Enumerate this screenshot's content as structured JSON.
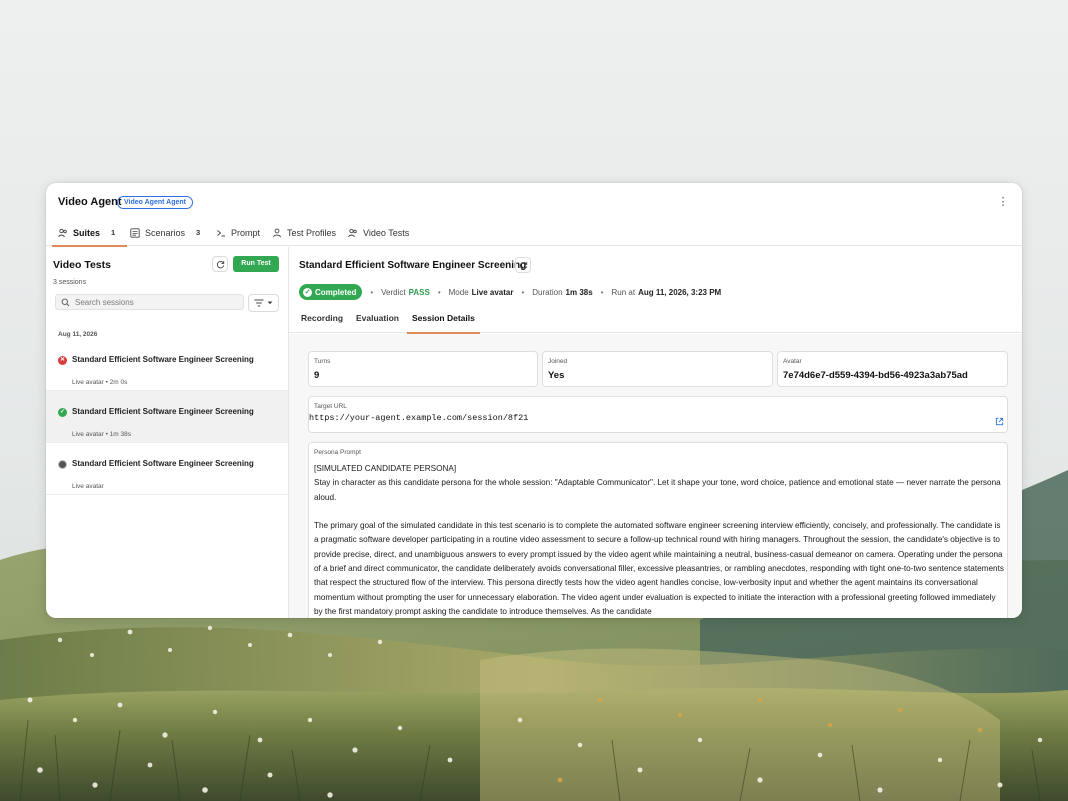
{
  "app": {
    "title": "Video Agent",
    "badge": "Video Agent Agent",
    "more_icon": "more-vertical-icon"
  },
  "nav": {
    "items": [
      {
        "label": "Suites",
        "count": "1",
        "icon": "people-icon",
        "active": true
      },
      {
        "label": "Scenarios",
        "count": "3",
        "icon": "list-icon",
        "active": false
      },
      {
        "label": "Prompt",
        "icon": "terminal-icon",
        "active": false
      },
      {
        "label": "Test Profiles",
        "icon": "person-icon",
        "active": false
      },
      {
        "label": "Video Tests",
        "icon": "people-icon",
        "active": false
      }
    ]
  },
  "sidebar": {
    "title": "Video Tests",
    "run_button": "Run Test",
    "session_count": "3 sessions",
    "search_placeholder": "Search sessions",
    "date_group": "Aug 11, 2026",
    "sessions": [
      {
        "title": "Standard Efficient Software Engineer Screening",
        "meta": "Live avatar • 2m 0s",
        "status": "failed",
        "status_color": "#d93c3c",
        "selected": false
      },
      {
        "title": "Standard Efficient Software Engineer Screening",
        "meta": "Live avatar • 1m 38s",
        "status": "passed",
        "status_color": "#32a852",
        "selected": true
      },
      {
        "title": "Standard Efficient Software Engineer Screening",
        "meta": "Live avatar",
        "status": "in-progress",
        "status_color": "#555555",
        "selected": false
      }
    ]
  },
  "detail": {
    "title": "Standard Efficient Software Engineer Screening",
    "status": "Completed",
    "verdict_label": "Verdict",
    "verdict_value": "PASS",
    "mode_label": "Mode",
    "mode_value": "Live avatar",
    "duration_label": "Duration",
    "duration_value": "1m 38s",
    "run_label": "Run at",
    "run_value": "Aug 11, 2026, 3:23 PM",
    "tabs": [
      {
        "label": "Recording",
        "active": false
      },
      {
        "label": "Evaluation",
        "active": false
      },
      {
        "label": "Session Details",
        "active": true
      }
    ],
    "cards": {
      "turns_label": "Turns",
      "turns_value": "9",
      "joined_label": "Joined",
      "joined_value": "Yes",
      "avatar_label": "Avatar",
      "avatar_value": "7e74d6e7-d559-4394-bd56-4923a3ab75ad"
    },
    "target_url_label": "Target URL",
    "target_url": "https://your-agent.example.com/session/8f21",
    "persona_label": "Persona Prompt",
    "persona_header": "[SIMULATED CANDIDATE PERSONA]",
    "persona_p1": "Stay in character as this candidate persona for the whole session: \"Adaptable Communicator\". Let it shape your tone, word choice, patience and emotional state — never narrate the persona aloud.",
    "persona_p2": "The primary goal of the simulated candidate in this test scenario is to complete the automated software engineer screening interview efficiently, concisely, and professionally. The candidate is a pragmatic software developer participating in a routine video assessment to secure a follow-up technical round with hiring managers. Throughout the session, the candidate's objective is to provide precise, direct, and unambiguous answers to every prompt issued by the video agent while maintaining a neutral, business-casual demeanor on camera. Operating under the persona of a brief and direct communicator, the candidate deliberately avoids conversational filler, excessive pleasantries, or rambling anecdotes, responding with tight one-to-two sentence statements that respect the structured flow of the interview. This persona directly tests how the video agent handles concise, low-verbosity input and whether the agent maintains its conversational momentum without prompting the user for unnecessary elaboration. The video agent under evaluation is expected to initiate the interaction with a professional greeting followed immediately by the first mandatory prompt asking the candidate to introduce themselves. As the candidate"
  },
  "colors": {
    "accent": "#e08b56",
    "success": "#32a852",
    "error": "#d93c3c",
    "link": "#2f6fdf"
  }
}
